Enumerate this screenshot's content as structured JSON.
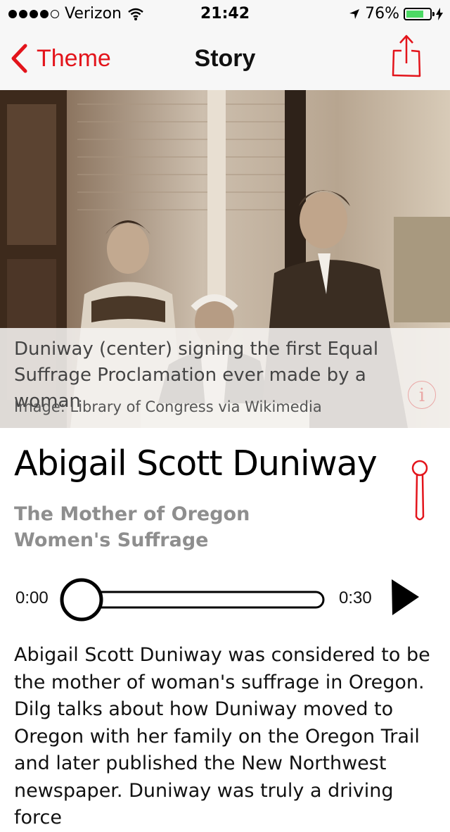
{
  "status_bar": {
    "carrier": "Verizon",
    "time": "21:42",
    "battery": "76%",
    "battery_level": 0.76,
    "signal_bars": 4
  },
  "nav": {
    "back_label": "Theme",
    "title": "Story",
    "accent_color": "#e3141b"
  },
  "hero": {
    "caption": "Duniway (center) signing the first Equal Suffrage Proclamation ever made by a woman",
    "credit": "Image: Library of Congress via Wikimedia",
    "info_glyph": "i"
  },
  "story": {
    "title": "Abigail Scott Duniway",
    "subtitle": "The Mother of Oregon Women's Suffrage",
    "body": "Abigail Scott Duniway was considered to be the mother of woman's suffrage in Oregon. Dilg talks about how Duniway moved to Oregon with her family on the Oregon Trail and later published the New Northwest newspaper. Duniway was truly a driving force"
  },
  "player": {
    "current_time": "0:00",
    "duration": "0:30",
    "progress": 0
  },
  "icons": {
    "back": "chevron-left-icon",
    "share": "share-icon",
    "info": "info-icon",
    "pin": "map-pin-icon",
    "play": "play-icon"
  }
}
